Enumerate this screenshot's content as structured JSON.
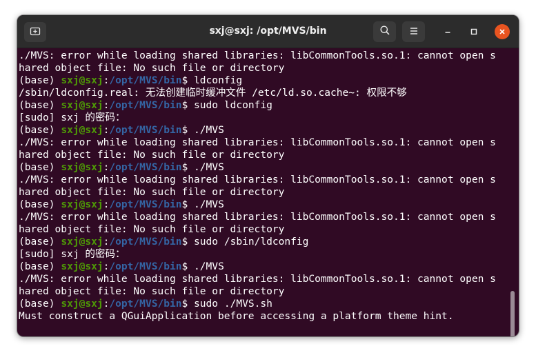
{
  "window": {
    "title": "sxj@sxj: /opt/MVS/bin"
  },
  "titlebar": {
    "icons": {
      "new_tab": "new-tab-icon",
      "search": "search-icon",
      "menu": "hamburger-menu-icon",
      "minimize": "minimize-icon",
      "maximize": "maximize-icon",
      "close": "close-icon"
    }
  },
  "prompt": {
    "env": "(base) ",
    "user": "sxj@sxj",
    "sep": ":",
    "path": "/opt/MVS/bin",
    "sigil": "$ "
  },
  "lines": [
    {
      "kind": "output",
      "text": "./MVS: error while loading shared libraries: libCommonTools.so.1: cannot open s"
    },
    {
      "kind": "output",
      "text": "hared object file: No such file or directory"
    },
    {
      "kind": "prompt",
      "cmd": "ldconfig"
    },
    {
      "kind": "output",
      "text": "/sbin/ldconfig.real: 无法创建临时缓冲文件 /etc/ld.so.cache~: 权限不够"
    },
    {
      "kind": "prompt",
      "cmd": "sudo ldconfig"
    },
    {
      "kind": "output",
      "text": "[sudo] sxj 的密码："
    },
    {
      "kind": "prompt",
      "cmd": "./MVS"
    },
    {
      "kind": "output",
      "text": "./MVS: error while loading shared libraries: libCommonTools.so.1: cannot open s"
    },
    {
      "kind": "output",
      "text": "hared object file: No such file or directory"
    },
    {
      "kind": "prompt",
      "cmd": "./MVS"
    },
    {
      "kind": "output",
      "text": "./MVS: error while loading shared libraries: libCommonTools.so.1: cannot open s"
    },
    {
      "kind": "output",
      "text": "hared object file: No such file or directory"
    },
    {
      "kind": "prompt",
      "cmd": "./MVS"
    },
    {
      "kind": "output",
      "text": "./MVS: error while loading shared libraries: libCommonTools.so.1: cannot open s"
    },
    {
      "kind": "output",
      "text": "hared object file: No such file or directory"
    },
    {
      "kind": "prompt",
      "cmd": "sudo /sbin/ldconfig"
    },
    {
      "kind": "output",
      "text": "[sudo] sxj 的密码："
    },
    {
      "kind": "prompt",
      "cmd": "./MVS"
    },
    {
      "kind": "output",
      "text": "./MVS: error while loading shared libraries: libCommonTools.so.1: cannot open s"
    },
    {
      "kind": "output",
      "text": "hared object file: No such file or directory"
    },
    {
      "kind": "prompt",
      "cmd": "sudo ./MVS.sh"
    },
    {
      "kind": "output",
      "text": "Must construct a QGuiApplication before accessing a platform theme hint."
    }
  ],
  "colors": {
    "background": "#300a24",
    "user_host": "#4e9a06",
    "path": "#3465a4",
    "text": "#ffffff",
    "close_button": "#e95420"
  }
}
